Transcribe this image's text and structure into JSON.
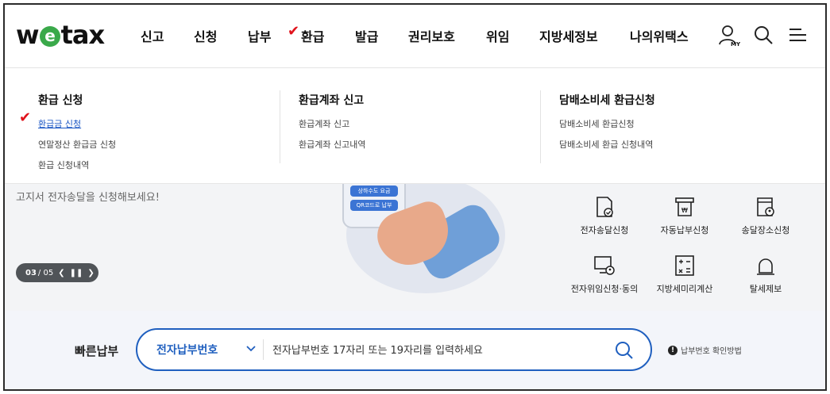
{
  "logo": {
    "part1": "w",
    "mark": "e",
    "part2": "tax"
  },
  "nav": [
    "신고",
    "신청",
    "납부",
    "환급",
    "발급",
    "권리보호",
    "위임",
    "지방세정보",
    "나의위택스"
  ],
  "header_icons": {
    "my": "MY",
    "items": [
      "user-icon",
      "search-icon",
      "menu-icon"
    ]
  },
  "dropdown": {
    "columns": [
      {
        "title": "환급 신청",
        "links": [
          "환급금 신청",
          "연말정산 환급금 신청",
          "환급 신청내역"
        ]
      },
      {
        "title": "환급계좌 신고",
        "links": [
          "환급계좌 신고",
          "환급계좌 신고내역"
        ]
      },
      {
        "title": "담배소비세 환급신청",
        "links": [
          "담배소비세 환급신청",
          "담배소비세 환급 신청내역"
        ]
      }
    ]
  },
  "banner": {
    "text": "고지서 전자송달을 신청해보세요!",
    "counter_current": "03",
    "counter_total": "/ 05",
    "phone_buttons": [
      "상하수도 요금",
      "QR코드로 납부"
    ]
  },
  "quick_menu": [
    "전자송달신청",
    "자동납부신청",
    "송달장소신청",
    "전자위임신청·동의",
    "지방세미리계산",
    "탈세제보"
  ],
  "quick_pay": {
    "label": "빠른납부",
    "select_value": "전자납부번호",
    "placeholder": "전자납부번호 17자리 또는 19자리를 입력하세요",
    "help_text": "납부번호 확인방법"
  },
  "colors": {
    "accent": "#1f5fbf",
    "check": "#e0121b",
    "logo_green": "#3aa94a"
  }
}
